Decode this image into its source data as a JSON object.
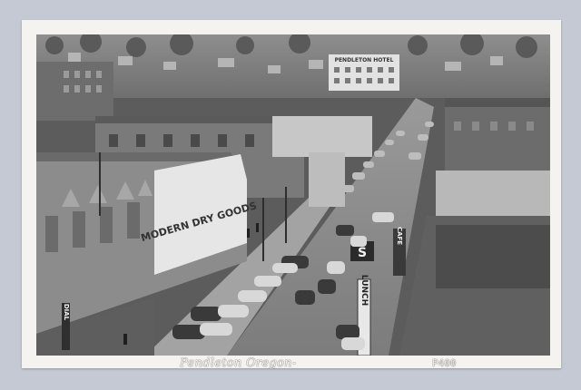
{
  "postcard": {
    "caption": "Pendleton Oregon-",
    "number": "P400",
    "signs": {
      "hotel": "PENDLETON HOTEL",
      "storefront": "MODERN DRY GOODS",
      "vertical_left": "DIAL",
      "vertical_right": "LUNCH",
      "tall_sign": "S",
      "small_sign": "CAFE"
    }
  },
  "colors": {
    "card": "#f4f3ef",
    "background": "#c4c9d3"
  }
}
